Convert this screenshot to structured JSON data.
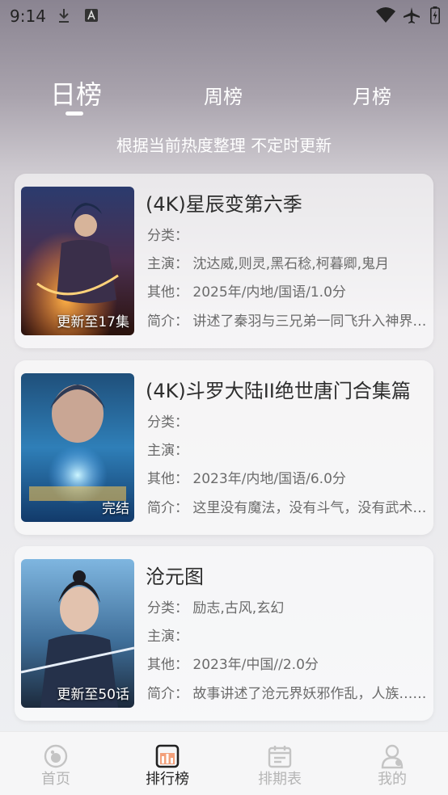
{
  "status": {
    "time": "9:14"
  },
  "tabs": {
    "day": "日榜",
    "week": "周榜",
    "month": "月榜"
  },
  "subtitle": "根据当前热度整理 不定时更新",
  "items": [
    {
      "title": "(4K)星辰变第六季",
      "badge": "更新至17集",
      "category": "分类：",
      "cast": "主演：  沈达威,则灵,黑石稔,柯暮卿,鬼月",
      "other": "其他：  2025年/内地/国语/1.0分",
      "intro": "简介：  讲述了秦羽与三兄弟一同飞升入神界……"
    },
    {
      "title": "(4K)斗罗大陆II绝世唐门合集篇",
      "badge": "完结",
      "category": "分类：",
      "cast": "主演：",
      "other": "其他：  2023年/内地/国语/6.0分",
      "intro": "简介：  这里没有魔法，没有斗气，没有武术……"
    },
    {
      "title": "沧元图",
      "badge": "更新至50话",
      "category": "分类：  励志,古风,玄幻",
      "cast": "主演：",
      "other": "其他：  2023年/中国//2.0分",
      "intro": "简介：  故事讲述了沧元界妖邪作乱，人族……"
    }
  ],
  "nav": {
    "home": "首页",
    "rank": "排行榜",
    "schedule": "排期表",
    "mine": "我的"
  },
  "colors": {
    "active": "#222222",
    "inactive": "#b5b5b5",
    "accent": "#f3a07a"
  }
}
